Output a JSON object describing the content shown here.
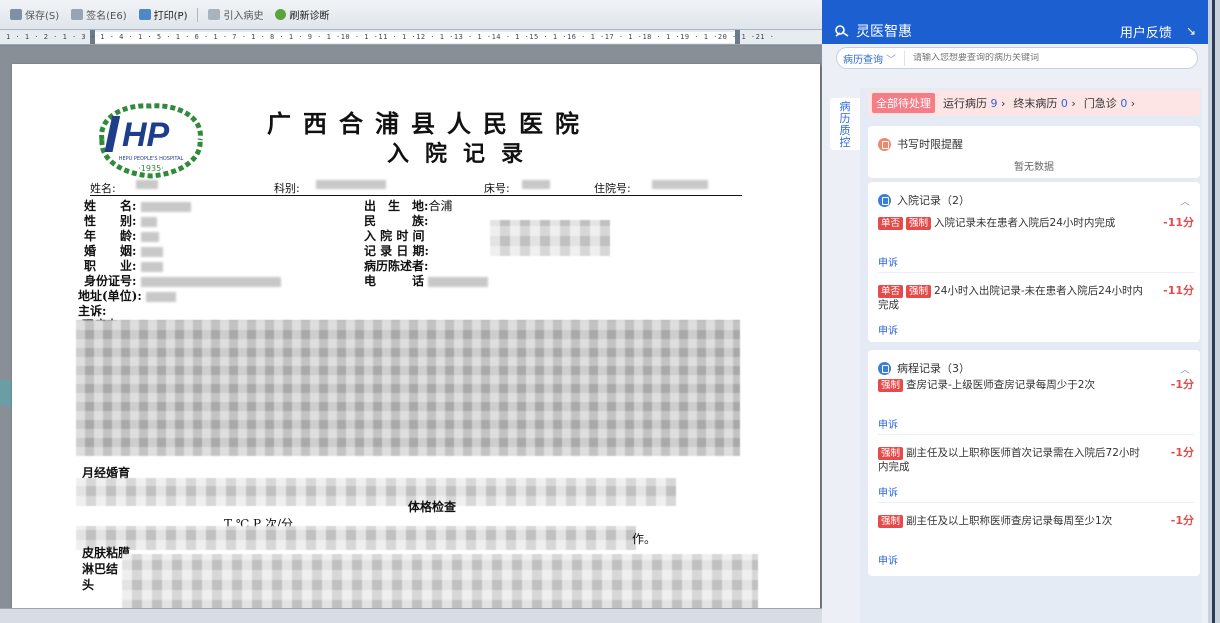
{
  "toolbar": {
    "buttons": [
      {
        "label": "保存(S)",
        "icon": "save-icon",
        "enabled": false
      },
      {
        "label": "签名(E6)",
        "icon": "sign-icon",
        "enabled": false
      },
      {
        "label": "打印(P)",
        "icon": "print-icon",
        "enabled": true
      },
      {
        "label": "引入病史",
        "icon": "import-icon",
        "enabled": false
      },
      {
        "label": "刷新诊断",
        "icon": "refresh-icon",
        "enabled": true
      }
    ]
  },
  "ruler": {
    "scale": "1 · 1 · 2 · 1 · 3 · 1 · 4 · 1 · 5 · 1 · 6 · 1 · 7 · 1 · 8 · 1 · 9 · 1 ·10 · 1 ·11 · 1 ·12 · 1 ·13 · 1 ·14 · 1 ·15 · 1 ·16 · 1 ·17 · 1 ·18 · 1 ·19 · 1 ·20 · 1 ·21 ·"
  },
  "document": {
    "logo_text": "HEPU PEOPLE'S HOSPITAL",
    "logo_year": "·1935·",
    "hospital_name": "广西合浦县人民医院",
    "title": "入院记录",
    "header": {
      "name_label": "姓名:",
      "dept_label": "科别:",
      "bed_label": "床号:",
      "admission_no_label": "住院号:"
    },
    "fields_left": [
      {
        "label": "姓　　名:",
        "value": ""
      },
      {
        "label": "性　　别:",
        "value": ""
      },
      {
        "label": "年　　龄:",
        "value": ""
      },
      {
        "label": "婚　　姻:",
        "value": ""
      },
      {
        "label": "职　　业:",
        "value": ""
      },
      {
        "label": "身份证号:",
        "value": ""
      },
      {
        "label": "地址(单位):",
        "value": ""
      },
      {
        "label": "主诉:",
        "value": ""
      }
    ],
    "fields_right": [
      {
        "label": "出　生　地:",
        "value": "合浦"
      },
      {
        "label": "民　　　族:",
        "value": ""
      },
      {
        "label": "入 院 时 间",
        "value": ""
      },
      {
        "label": "记 录 日 期:",
        "value": ""
      },
      {
        "label": "病历陈述者:",
        "value": ""
      },
      {
        "label": "电　　　话",
        "value": ""
      }
    ],
    "fragments": {
      "present_illness": "现病史",
      "menstrual": "月经婚育",
      "physical_exam": "体格检查",
      "vitals": "T  ℃ P  次/分",
      "skin": "皮肤粘膜",
      "lymph": "淋巴结",
      "head": "头",
      "period_end": "作。"
    }
  },
  "panel": {
    "brand": "灵医智惠",
    "feedback": "用户反馈",
    "search": {
      "type": "病历查询",
      "placeholder": "请输入您想要查询的病历关键词"
    },
    "vertical_tab": [
      "病",
      "历",
      "质",
      "控"
    ],
    "status": {
      "main": "全部待处理",
      "running_label": "运行病历",
      "running_count": "9",
      "final_label": "终末病历",
      "final_count": "0",
      "clinic_label": "门急诊",
      "clinic_count": "0"
    },
    "time_reminder": {
      "title": "书写时限提醒",
      "empty": "暂无数据"
    },
    "sections": [
      {
        "title": "入院记录（2）",
        "items": [
          {
            "tags": [
              "单否",
              "强制"
            ],
            "text": "入院记录未在患者入院后24小时内完成",
            "score": "-11分",
            "action": "申诉"
          },
          {
            "tags": [
              "单否",
              "强制"
            ],
            "text": "24小时入出院记录-未在患者入院后24小时内完成",
            "score": "-11分",
            "action": "申诉"
          }
        ]
      },
      {
        "title": "病程记录（3）",
        "items": [
          {
            "tags": [
              "强制"
            ],
            "text": "查房记录-上级医师查房记录每周少于2次",
            "score": "-1分",
            "action": "申诉"
          },
          {
            "tags": [
              "强制"
            ],
            "text": "副主任及以上职称医师首次记录需在入院后72小时内完成",
            "score": "-1分",
            "action": "申诉"
          },
          {
            "tags": [
              "强制"
            ],
            "text": "副主任及以上职称医师查房记录每周至少1次",
            "score": "-1分",
            "action": "申诉"
          }
        ]
      }
    ]
  }
}
